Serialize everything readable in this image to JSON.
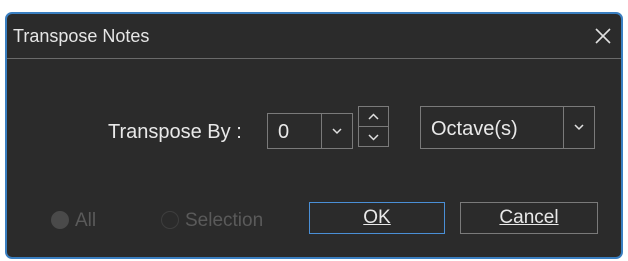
{
  "dialog": {
    "title": "Transpose Notes",
    "close_icon": "close-icon"
  },
  "transpose": {
    "label": "Transpose By :",
    "amount_value": "0",
    "unit_value": "Octave(s)",
    "spinner_up_icon": "chevron-up-icon",
    "spinner_down_icon": "chevron-down-icon"
  },
  "scope": {
    "options": [
      {
        "label": "All",
        "selected": true,
        "enabled": false
      },
      {
        "label": "Selection",
        "selected": false,
        "enabled": false
      }
    ]
  },
  "buttons": {
    "ok_label": "OK",
    "cancel_label": "Cancel"
  },
  "colors": {
    "background": "#2b2b2b",
    "border_accent": "#3a7fc1",
    "text": "#e9e9e9",
    "disabled_text": "#5a5a5a"
  }
}
